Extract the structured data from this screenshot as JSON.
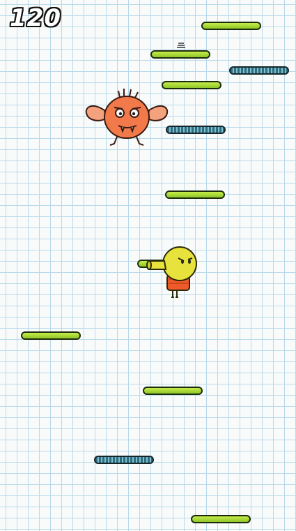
{
  "hud": {
    "score": "120"
  },
  "platforms": [
    {
      "kind": "green"
    },
    {
      "kind": "green"
    },
    {
      "kind": "blue"
    },
    {
      "kind": "green"
    },
    {
      "kind": "blue"
    },
    {
      "kind": "green"
    },
    {
      "kind": "green"
    },
    {
      "kind": "green"
    },
    {
      "kind": "green"
    },
    {
      "kind": "blue"
    },
    {
      "kind": "green"
    }
  ],
  "characters": {
    "player": {
      "name": "doodler",
      "color": "#e8e23c",
      "shirt": "#ef5a2a"
    },
    "enemy": {
      "name": "orange-winged-monster",
      "color": "#f27a4a"
    }
  },
  "colors": {
    "platform_green": "#9ed22e",
    "platform_blue": "#2e6c7e",
    "grid": "#b9d9ea"
  }
}
